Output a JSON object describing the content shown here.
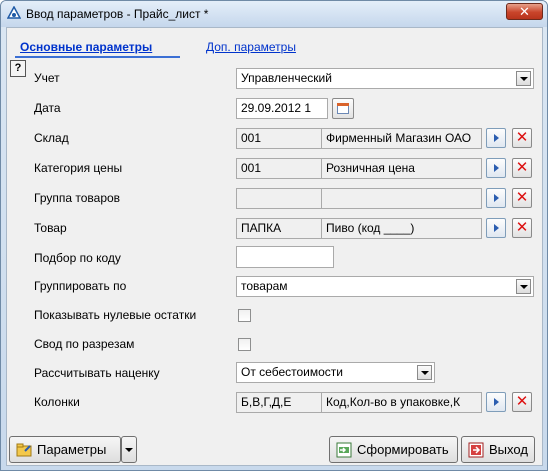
{
  "window": {
    "title": "Ввод параметров - Прайс_лист *",
    "close_label": "✕"
  },
  "tabs": {
    "main": "Основные параметры",
    "extra": "Доп. параметры"
  },
  "help_icon_label": "?",
  "fields": {
    "uchet": {
      "label": "Учет",
      "value": "Управленческий"
    },
    "date": {
      "label": "Дата",
      "value": "29.09.2012 1"
    },
    "warehouse": {
      "label": "Склад",
      "code": "001",
      "name": "Фирменный Магазин ОАО"
    },
    "price_category": {
      "label": "Категория цены",
      "code": "001",
      "name": "Розничная цена"
    },
    "goods_group": {
      "label": "Группа товаров",
      "code": "",
      "name": ""
    },
    "goods": {
      "label": "Товар",
      "code": "ПАПКА",
      "name": "Пиво (код ____)"
    },
    "code_filter": {
      "label": "Подбор по коду",
      "value": ""
    },
    "group_by": {
      "label": "Группировать по",
      "value": "товарам"
    },
    "show_zero": {
      "label": "Показывать нулевые остатки",
      "checked": false
    },
    "svod": {
      "label": "Свод по разрезам",
      "checked": false
    },
    "markup": {
      "label": "Рассчитывать наценку",
      "value": "От себестоимости"
    },
    "columns": {
      "label": "Колонки",
      "code": "Б,В,Г,Д,Е",
      "name": "Код,Кол-во в упаковке,К"
    }
  },
  "buttons": {
    "params": "Параметры",
    "form": "Сформировать",
    "exit": "Выход"
  },
  "icons": {
    "window": "app-icon",
    "calendar": "calendar-icon",
    "pick": "select-arrow-icon",
    "clear": "delete-x-icon",
    "params": "folder-icon",
    "form": "report-icon",
    "exit": "exit-icon"
  },
  "colors": {
    "tab_link": "#0033cc",
    "clear_x": "#dd1111",
    "titlebar": "#c5d7ec"
  }
}
